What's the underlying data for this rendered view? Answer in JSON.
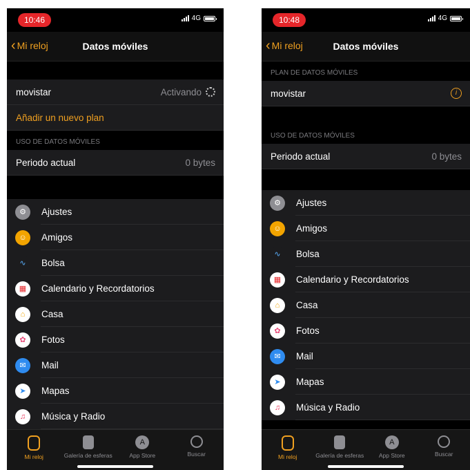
{
  "left": {
    "status_time": "10:46",
    "network": "4G",
    "nav": {
      "back": "Mi reloj",
      "title": "Datos móviles"
    },
    "plan": {
      "carrier": "movistar",
      "status": "Activando",
      "add_plan": "Añadir un nuevo plan"
    },
    "usage": {
      "header": "USO DE DATOS MÓVILES",
      "period_label": "Periodo actual",
      "period_value": "0 bytes"
    },
    "apps": [
      "Ajustes",
      "Amigos",
      "Bolsa",
      "Calendario y Recordatorios",
      "Casa",
      "Fotos",
      "Mail",
      "Mapas",
      "Música y Radio"
    ]
  },
  "right": {
    "status_time": "10:48",
    "network": "4G",
    "nav": {
      "back": "Mi reloj",
      "title": "Datos móviles"
    },
    "plan": {
      "header": "PLAN DE DATOS MÓVILES",
      "carrier": "movistar"
    },
    "usage": {
      "header": "USO DE DATOS MÓVILES",
      "period_label": "Periodo actual",
      "period_value": "0 bytes"
    },
    "apps": [
      "Ajustes",
      "Amigos",
      "Bolsa",
      "Calendario y Recordatorios",
      "Casa",
      "Fotos",
      "Mail",
      "Mapas",
      "Música y Radio"
    ]
  },
  "tabs": [
    "Mi reloj",
    "Galería de esferas",
    "App Store",
    "Buscar"
  ],
  "colors": {
    "accent": "#f0a020",
    "status_pill": "#e5262a",
    "cell_bg": "#1c1c1e"
  }
}
